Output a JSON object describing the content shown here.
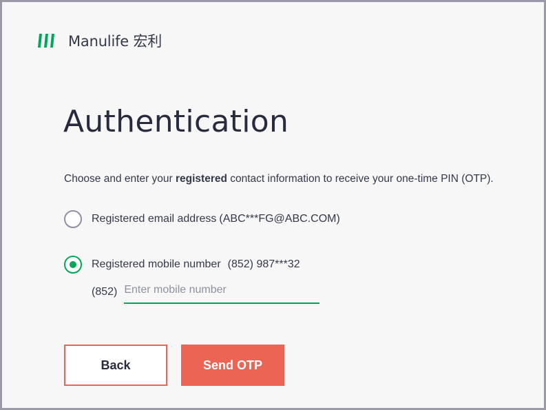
{
  "brand": {
    "name": "Manulife 宏利",
    "color": "#00a758"
  },
  "page": {
    "title": "Authentication",
    "instruction_prefix": "Choose and enter your ",
    "instruction_bold": "registered",
    "instruction_suffix": " contact information to receive your one-time PIN (OTP)."
  },
  "options": {
    "email": {
      "label": "Registered email address",
      "value": "(ABC***FG@ABC.COM)",
      "selected": false
    },
    "mobile": {
      "label": "Registered mobile number",
      "value": "(852) 987***32",
      "selected": true
    }
  },
  "phone_input": {
    "country_code": "(852)",
    "placeholder": "Enter mobile number",
    "value": ""
  },
  "buttons": {
    "back_label": "Back",
    "send_label": "Send OTP"
  },
  "colors": {
    "accent_green": "#00a758",
    "coral": "#ec6453",
    "text": "#34384b"
  }
}
